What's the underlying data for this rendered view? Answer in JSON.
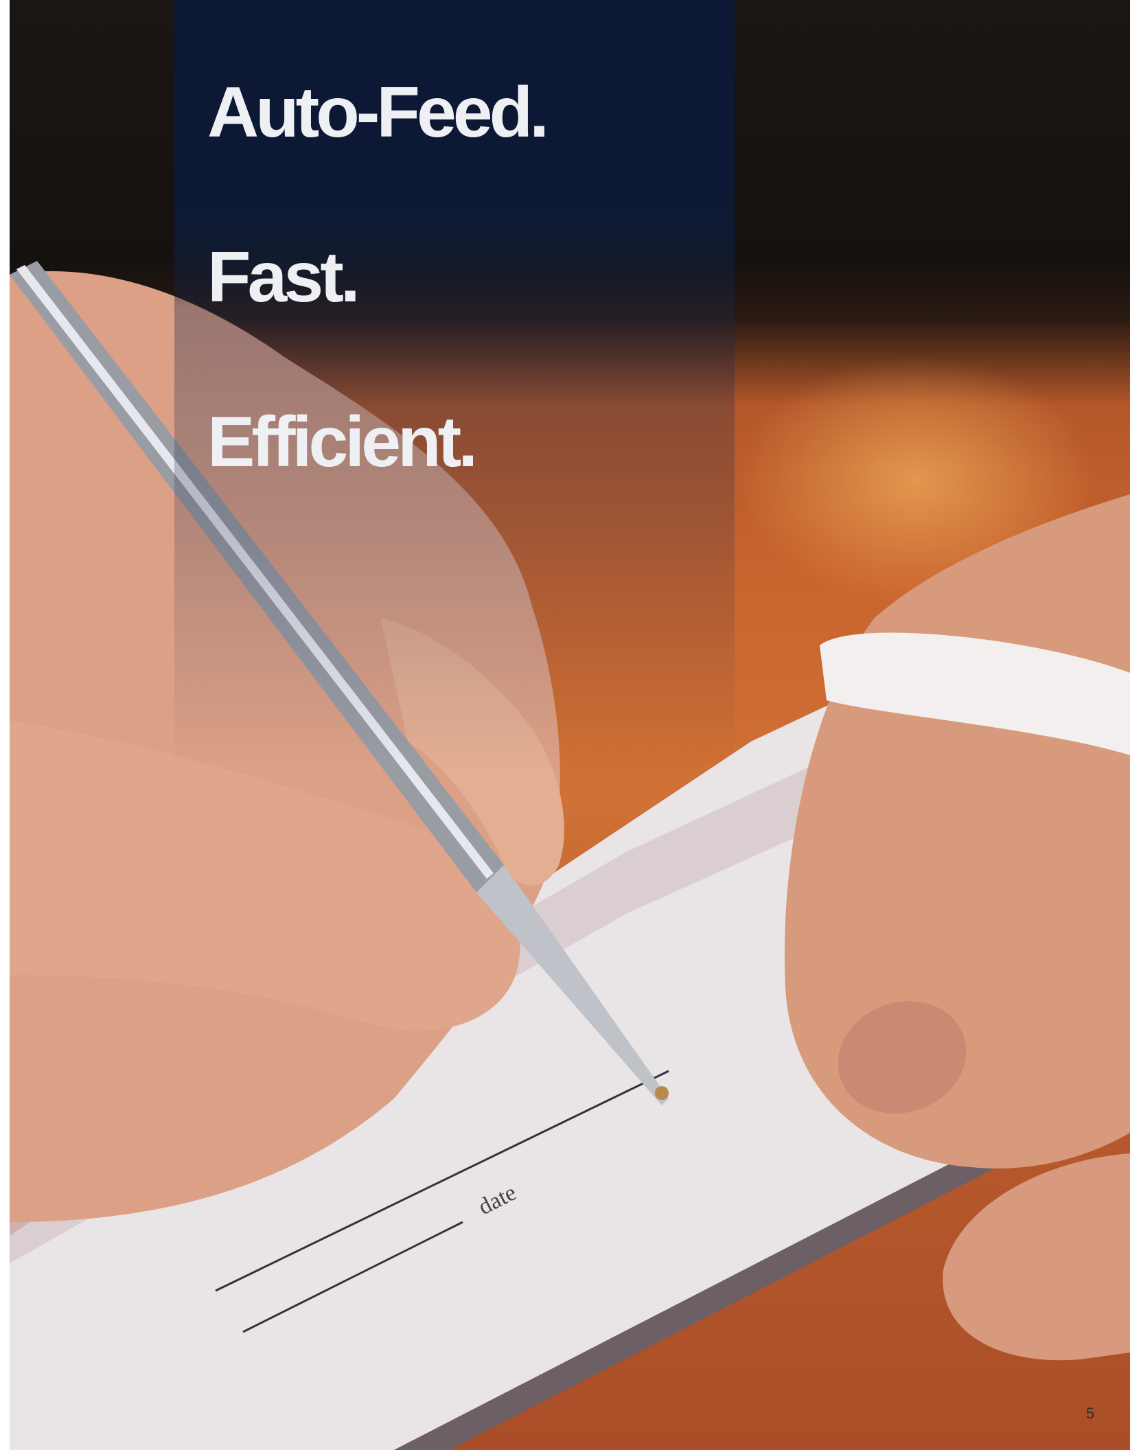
{
  "headlines": {
    "line1": "Auto-Feed.",
    "line2": "Fast.",
    "line3": "Efficient."
  },
  "photo": {
    "check_label": "date"
  },
  "page_number": "5",
  "colors": {
    "panel_navy": "#0c1834",
    "headline_text": "#eef0f4",
    "desk_orange": "#c9642e"
  }
}
